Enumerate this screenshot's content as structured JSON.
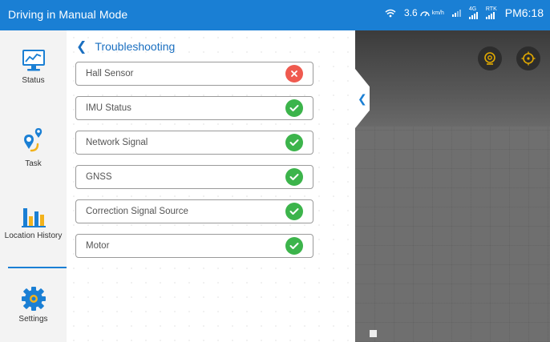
{
  "topbar": {
    "title": "Driving in Manual Mode",
    "speed_value": "3.6",
    "speed_unit": "km/h",
    "signal1_label": "4G",
    "signal2_label": "RTK",
    "time": "PM6:18"
  },
  "sidebar": {
    "items": [
      {
        "label": "Status",
        "icon": "monitor-chart-icon"
      },
      {
        "label": "Task",
        "icon": "location-pins-icon"
      },
      {
        "label": "Location History",
        "icon": "bar-chart-icon"
      },
      {
        "label": "Settings",
        "icon": "gear-icon"
      }
    ]
  },
  "main": {
    "title": "Troubleshooting",
    "rows": [
      {
        "name": "Hall Sensor",
        "status": "error"
      },
      {
        "name": "IMU Status",
        "status": "ok"
      },
      {
        "name": "Network Signal",
        "status": "ok"
      },
      {
        "name": "GNSS",
        "status": "ok"
      },
      {
        "name": "Correction Signal Source",
        "status": "ok"
      },
      {
        "name": "Motor",
        "status": "ok"
      }
    ]
  },
  "colors": {
    "accent": "#1a7fd4",
    "ok": "#3cb44b",
    "error": "#ef5a4f",
    "view_button_accent": "#e0a800"
  }
}
